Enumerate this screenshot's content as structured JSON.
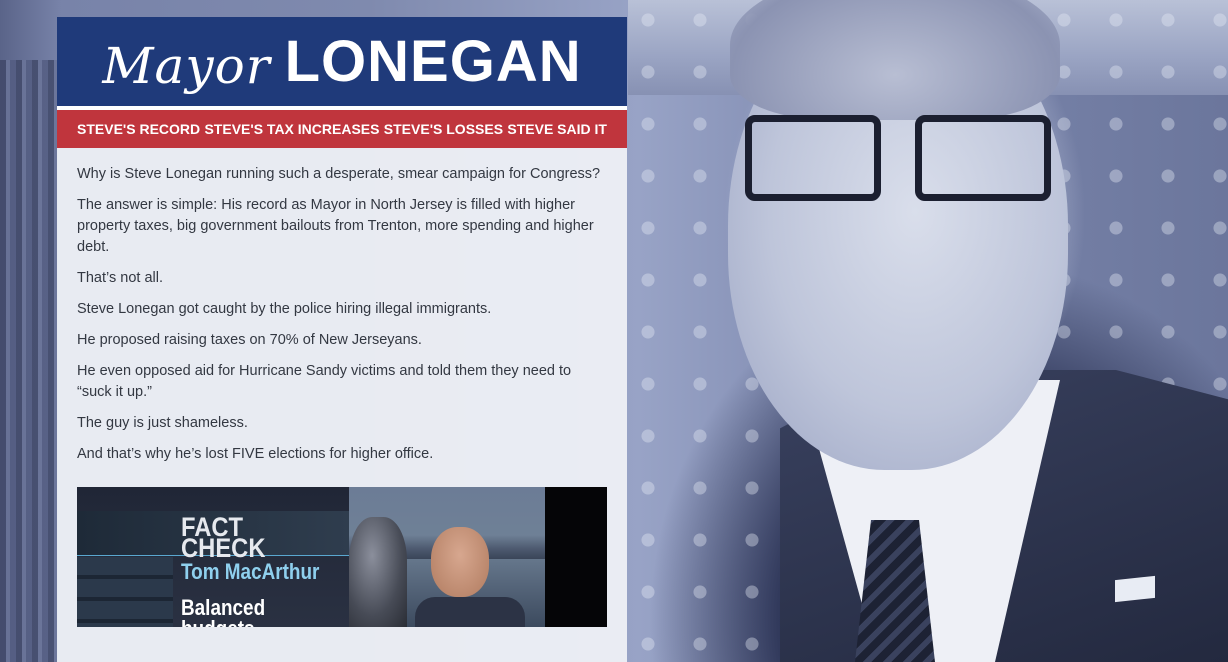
{
  "header": {
    "logo_script": "Mayor",
    "logo_main": "LONEGAN"
  },
  "nav": {
    "items": [
      {
        "label": "STEVE'S RECORD"
      },
      {
        "label": "STEVE'S TAX INCREASES"
      },
      {
        "label": "STEVE'S LOSSES"
      },
      {
        "label": "STEVE SAID IT"
      }
    ]
  },
  "content": {
    "paragraphs": [
      "Why is Steve Lonegan running such a desperate, smear campaign for Congress?",
      "The answer is simple: His record as Mayor in North Jersey is filled with higher property taxes, big government bailouts from Trenton, more spending and higher debt.",
      "That’s not all.",
      "Steve Lonegan got caught by the police hiring illegal immigrants.",
      "He proposed raising taxes on 70% of New Jerseyans.",
      "He even opposed aid for Hurricane Sandy victims and told them they need to “suck it up.”",
      "The guy is just shameless.",
      "And that’s why he’s lost FIVE elections for higher office."
    ]
  },
  "video": {
    "title": "FACT CHECK",
    "name": "Tom MacArthur",
    "subtitle": "Balanced budgets"
  },
  "colors": {
    "header_blue": "#1f3a7a",
    "nav_red": "#c0353d"
  }
}
